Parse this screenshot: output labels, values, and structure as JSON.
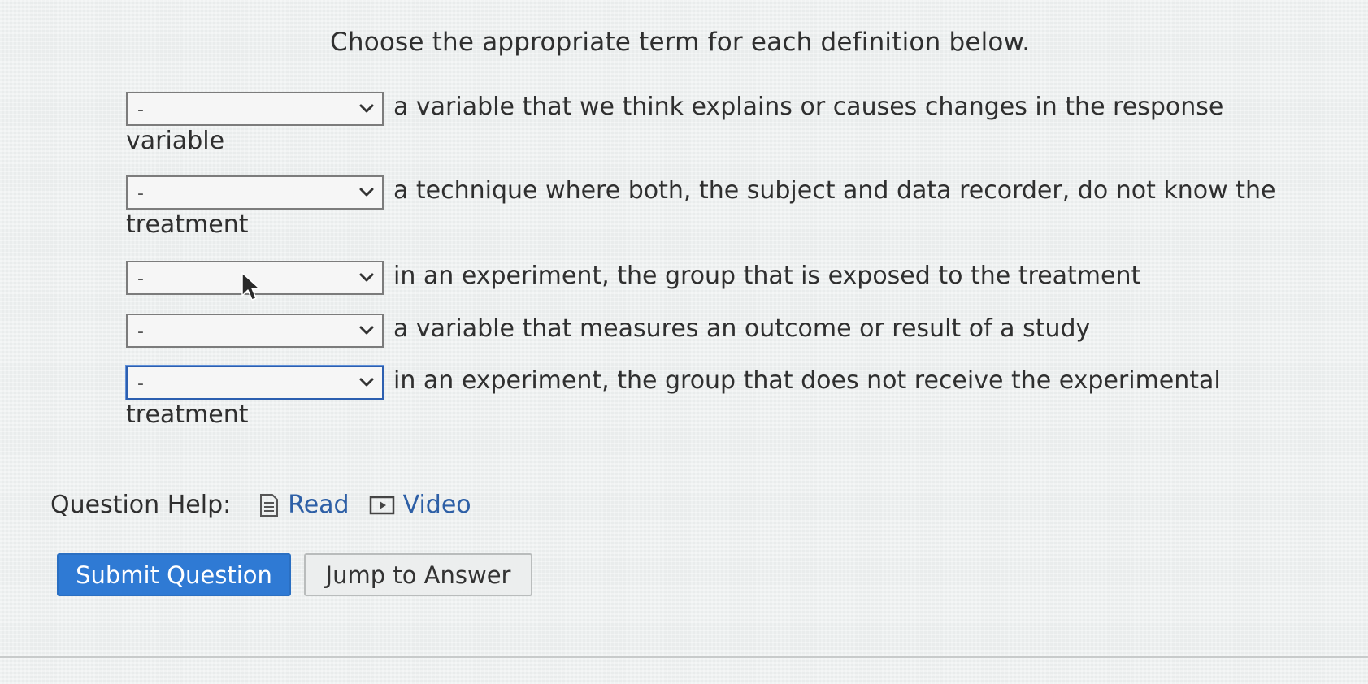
{
  "question": {
    "prompt": "Choose the appropriate term for each definition below."
  },
  "items": [
    {
      "selected": "-",
      "definition": "a variable that we think explains or causes changes in the response variable"
    },
    {
      "selected": "-",
      "definition": "a technique where both, the subject and data recorder, do not know the treatment"
    },
    {
      "selected": "-",
      "definition": "in an experiment, the group that is exposed to the treatment"
    },
    {
      "selected": "-",
      "definition": "a variable that measures an outcome or result of a study"
    },
    {
      "selected": "-",
      "definition": "in an experiment, the group that does not receive the experimental treatment"
    }
  ],
  "help": {
    "label": "Question Help:",
    "read_label": "Read",
    "video_label": "Video",
    "read_icon": "document-icon",
    "video_icon": "play-icon"
  },
  "buttons": {
    "submit_label": "Submit Question",
    "jump_label": "Jump to Answer"
  },
  "colors": {
    "accent": "#2f7ad4",
    "link": "#2d5fa6",
    "focus": "#2c5fb0"
  }
}
